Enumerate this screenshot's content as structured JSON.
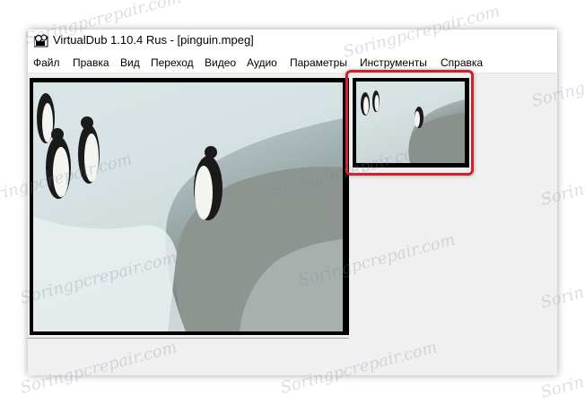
{
  "window": {
    "title": "VirtualDub 1.10.4 Rus - [pinguin.mpeg]",
    "icon": "virtualdub-app-icon"
  },
  "menu": {
    "items": [
      "Файл",
      "Правка",
      "Вид",
      "Переход",
      "Видео",
      "Аудио",
      "Параметры",
      "Инструменты",
      "Справка"
    ]
  },
  "panes": {
    "input_icon": "video-frame-image",
    "output_icon": "video-thumbnail-image"
  },
  "watermark": {
    "text": "Soringpcrepair.com"
  },
  "colors": {
    "highlight": "#d2202a",
    "window_bg": "#f0f0f0",
    "frame_border": "#000000"
  }
}
